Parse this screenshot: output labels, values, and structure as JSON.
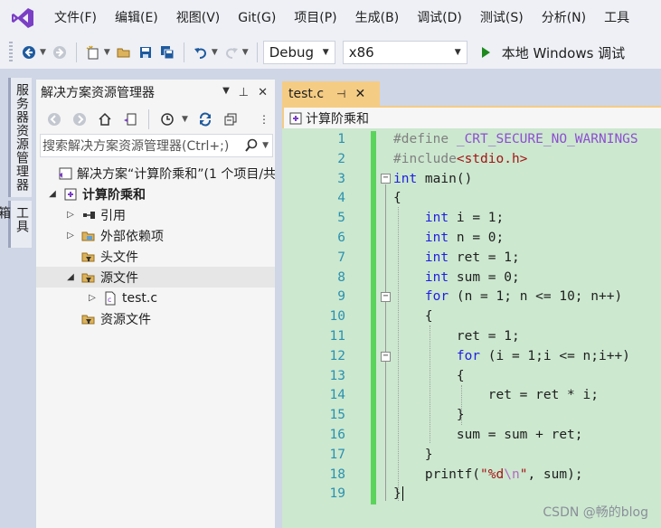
{
  "menu": [
    "文件(F)",
    "编辑(E)",
    "视图(V)",
    "Git(G)",
    "项目(P)",
    "生成(B)",
    "调试(D)",
    "测试(S)",
    "分析(N)",
    "工具"
  ],
  "toolbar": {
    "config": "Debug",
    "platform": "x86",
    "run_label": "本地 Windows 调试"
  },
  "side_tabs": [
    "服务器资源管理器",
    "工具箱"
  ],
  "solution_explorer": {
    "title": "解决方案资源管理器",
    "search_placeholder": "搜索解决方案资源管理器(Ctrl+;)",
    "tree": [
      {
        "label": "解决方案“计算阶乘和”(1 个项目/共",
        "bold": false
      },
      {
        "label": "计算阶乘和",
        "bold": true
      },
      {
        "label": "引用"
      },
      {
        "label": "外部依赖项"
      },
      {
        "label": "头文件"
      },
      {
        "label": "源文件"
      },
      {
        "label": "test.c"
      },
      {
        "label": "资源文件"
      }
    ]
  },
  "editor": {
    "tab_name": "test.c",
    "nav_scope": "计算阶乘和",
    "line_numbers": [
      "1",
      "2",
      "3",
      "4",
      "5",
      "6",
      "7",
      "8",
      "9",
      "10",
      "11",
      "12",
      "13",
      "14",
      "15",
      "16",
      "17",
      "18",
      "19"
    ]
  },
  "watermark": "CSDN @畅的blog",
  "colors": {
    "tab_active": "#f5cc84",
    "editor_bg": "#cce8cf",
    "keyword": "#2020e0",
    "line_number": "#2b91af"
  }
}
